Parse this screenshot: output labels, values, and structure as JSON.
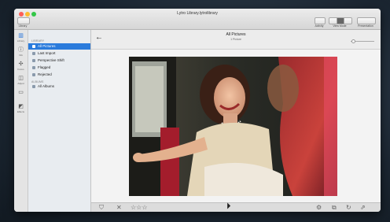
{
  "window": {
    "title": "Lytro Library.lytrolibrary"
  },
  "toolbar": {
    "sidebar_label": "Library",
    "activity_label": "Activity",
    "view_mode_label": "View Mode",
    "presentation_label": "Presentation"
  },
  "rail": {
    "items": [
      {
        "label": "Library",
        "icon": "library-icon"
      },
      {
        "label": "Info",
        "icon": "info-icon"
      },
      {
        "label": "Focus",
        "icon": "focus-icon"
      },
      {
        "label": "Adjust",
        "icon": "adjust-icon"
      },
      {
        "label": "",
        "icon": "crop-icon"
      },
      {
        "label": "Effects",
        "icon": "effects-icon"
      }
    ]
  },
  "sourcelist": {
    "library_header": "LIBRARY",
    "items": [
      "All Pictures",
      "Last Import",
      "Perspective Shift",
      "Flagged",
      "Rejected"
    ],
    "albums_header": "ALBUMS",
    "albums": [
      "All Albums"
    ]
  },
  "content": {
    "title": "All Pictures",
    "subtitle": "1 Picture",
    "zoom_fraction": 0.1
  },
  "rating": {
    "value": 3,
    "max": 3
  },
  "colors": {
    "accent": "#2a7bdc",
    "sidebar_bg": "#e8ecf0",
    "photo_car_red": "#c0213a"
  }
}
